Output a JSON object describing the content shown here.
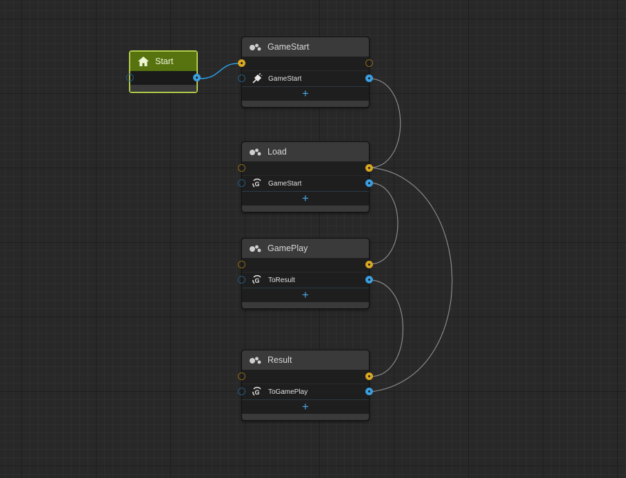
{
  "start_node": {
    "label": "Start",
    "icon": "home-icon"
  },
  "states": [
    {
      "id": "gamestart",
      "title": "GameStart",
      "icon": "state-gear-icon",
      "transition": {
        "label": "GameStart",
        "icon": "start-event-icon"
      },
      "add_label": "+"
    },
    {
      "id": "load",
      "title": "Load",
      "icon": "state-gear-icon",
      "transition": {
        "label": "GameStart",
        "icon": "custom-event-icon"
      },
      "add_label": "+"
    },
    {
      "id": "gameplay",
      "title": "GamePlay",
      "icon": "state-gear-icon",
      "transition": {
        "label": "ToResult",
        "icon": "custom-event-icon"
      },
      "add_label": "+"
    },
    {
      "id": "result",
      "title": "Result",
      "icon": "state-gear-icon",
      "transition": {
        "label": "ToGamePlay",
        "icon": "custom-event-icon"
      },
      "add_label": "+"
    }
  ],
  "colors": {
    "flow_port": "#d9a623",
    "transition_port": "#3a9ee0",
    "start_border": "#b2cc4a",
    "start_header": "#56730f",
    "wire_active": "#2aa1e6",
    "wire": "#8a8a8a"
  }
}
